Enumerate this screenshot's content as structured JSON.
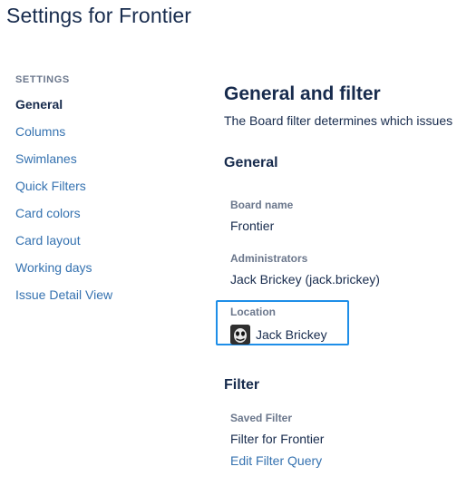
{
  "page": {
    "title": "Settings for Frontier"
  },
  "sidebar": {
    "heading": "SETTINGS",
    "items": [
      {
        "label": "General",
        "active": true
      },
      {
        "label": "Columns",
        "active": false
      },
      {
        "label": "Swimlanes",
        "active": false
      },
      {
        "label": "Quick Filters",
        "active": false
      },
      {
        "label": "Card colors",
        "active": false
      },
      {
        "label": "Card layout",
        "active": false
      },
      {
        "label": "Working days",
        "active": false
      },
      {
        "label": "Issue Detail View",
        "active": false
      }
    ]
  },
  "main": {
    "heading": "General and filter",
    "description": "The Board filter determines which issues",
    "general": {
      "heading": "General",
      "board_name_label": "Board name",
      "board_name_value": "Frontier",
      "administrators_label": "Administrators",
      "administrators_value": "Jack Brickey (jack.brickey)",
      "location_label": "Location",
      "location_value": "Jack Brickey",
      "location_avatar_icon": "user-avatar-icon"
    },
    "filter": {
      "heading": "Filter",
      "saved_filter_label": "Saved Filter",
      "saved_filter_value": "Filter for Frontier",
      "edit_link": "Edit Filter Query"
    }
  },
  "colors": {
    "text": "#172b4d",
    "link": "#3572b0",
    "label": "#6b778c",
    "highlight_border": "#1e8ee8"
  }
}
